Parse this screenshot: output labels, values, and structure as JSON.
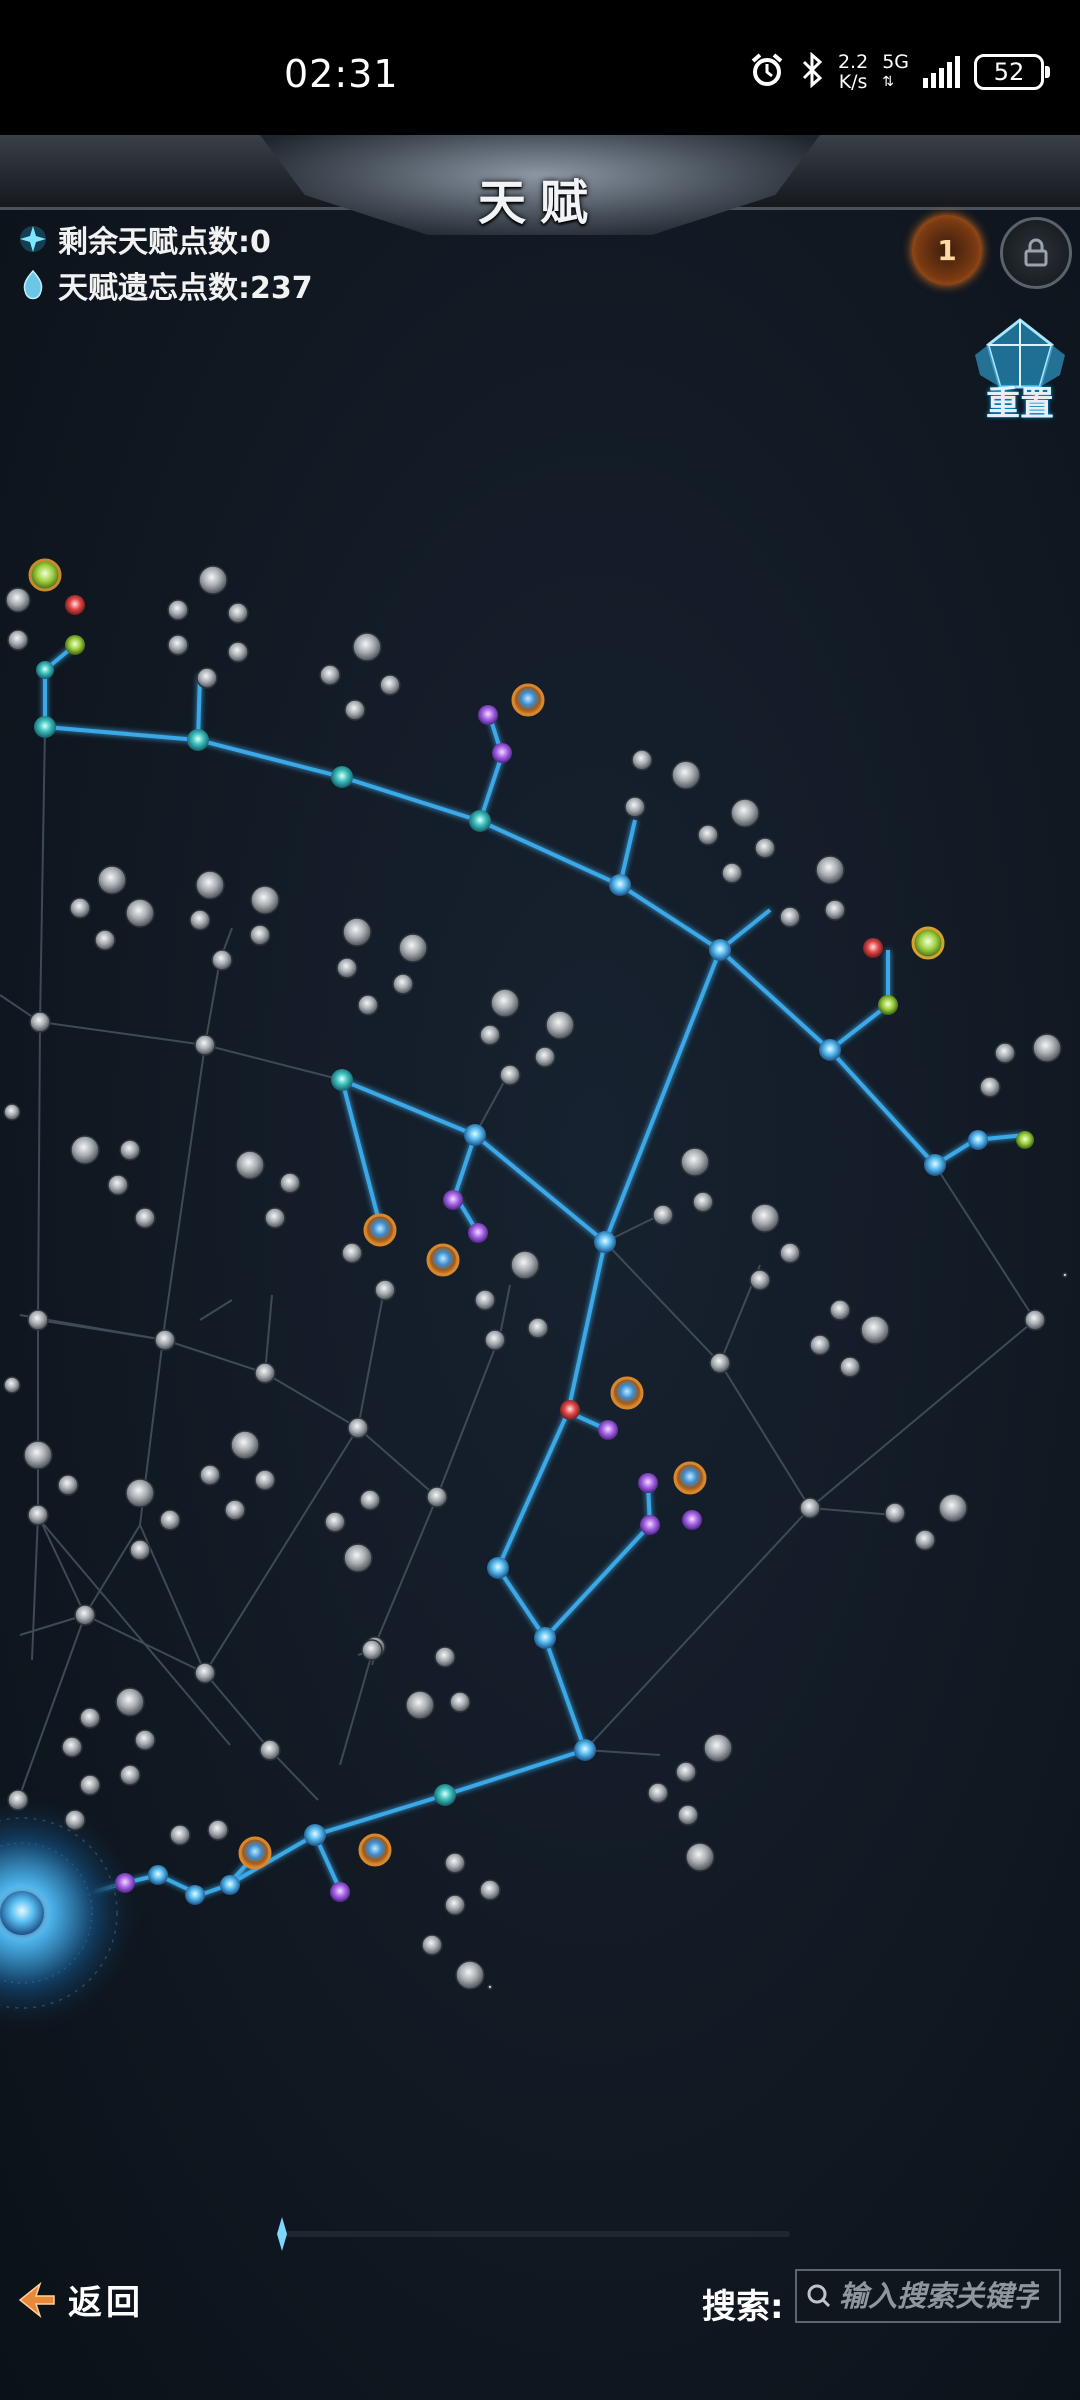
{
  "status_bar": {
    "time": "02:31",
    "speed_value": "2.2",
    "speed_unit": "K/s",
    "network": "5G",
    "battery": "52",
    "icons": [
      "alarm-icon",
      "bluetooth-icon",
      "signal-icon",
      "battery-icon"
    ]
  },
  "header": {
    "title": "天赋"
  },
  "stats": {
    "remaining_points": "剩余天赋点数:0",
    "forget_points": "天赋遗忘点数:237"
  },
  "buttons": {
    "reset_label": "重置",
    "back_label": "返回",
    "level_badge": "1"
  },
  "search": {
    "label": "搜索:",
    "placeholder": "输入搜索关键字"
  },
  "colors": {
    "active_line": "#39a7e6",
    "inactive_line": "#3d4954",
    "active_node": "#7fd3ff",
    "inactive_node": "#cfd3d6",
    "background": "#121a23"
  }
}
